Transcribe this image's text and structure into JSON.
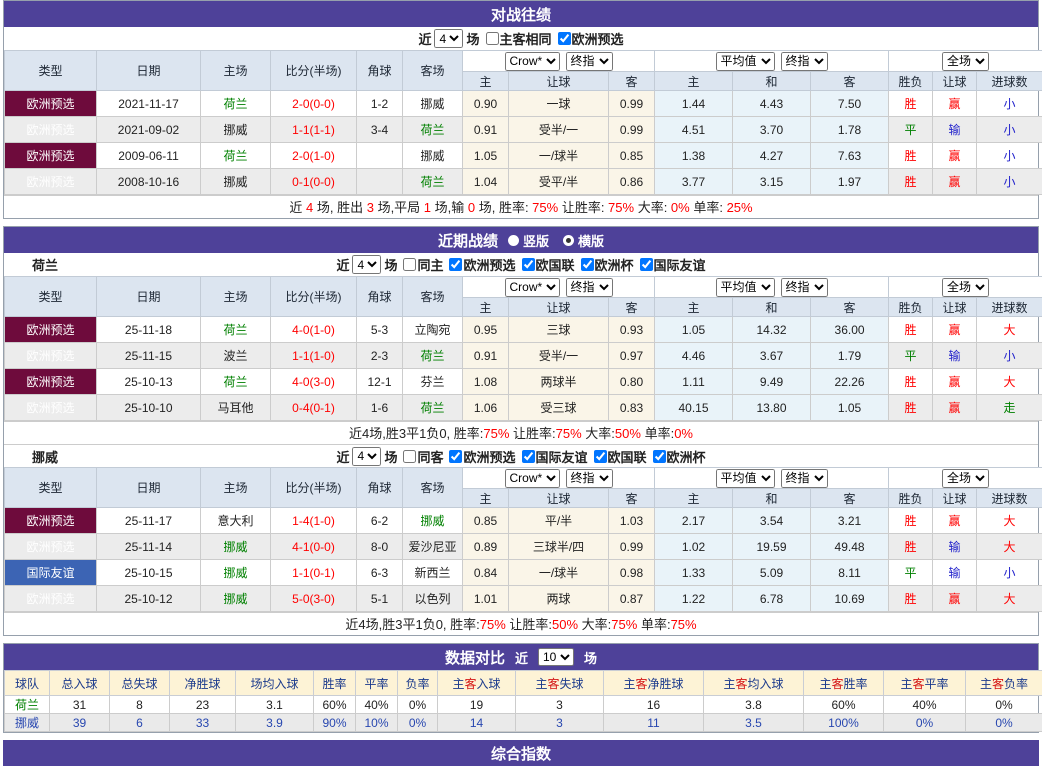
{
  "match_header": {
    "main_cols": [
      "类型",
      "日期",
      "主场",
      "比分(半场)",
      "角球",
      "客场"
    ],
    "dropdowns": [
      "Crow*",
      "终指",
      "平均值",
      "终指",
      "全场"
    ],
    "sub_cols": [
      "主",
      "让球",
      "客",
      "主",
      "和",
      "客",
      "胜负",
      "让球",
      "进球数"
    ]
  },
  "h2h": {
    "title": "对战往绩",
    "controls": {
      "prefix": "近",
      "games": "4",
      "suffix": "场",
      "checks": [
        {
          "label": "主客相同",
          "checked": false
        },
        {
          "label": "欧洲预选",
          "checked": true
        }
      ]
    },
    "rows": [
      [
        [
          "欧洲预选",
          "m"
        ],
        [
          "2021-11-17",
          ""
        ],
        [
          "荷兰",
          "g"
        ],
        [
          "2-0(0-0)",
          "r"
        ],
        [
          "1-2",
          ""
        ],
        [
          "挪威",
          ""
        ],
        [
          "0.90",
          ""
        ],
        [
          "一球",
          ""
        ],
        [
          "0.99",
          ""
        ],
        [
          "1.44",
          ""
        ],
        [
          "4.43",
          ""
        ],
        [
          "7.50",
          ""
        ],
        [
          "胜",
          "r"
        ],
        [
          "赢",
          "r"
        ],
        [
          "小",
          "b"
        ]
      ],
      [
        [
          "欧洲预选",
          "m"
        ],
        [
          "2021-09-02",
          ""
        ],
        [
          "挪威",
          ""
        ],
        [
          "1-1(1-1)",
          "r"
        ],
        [
          "3-4",
          ""
        ],
        [
          "荷兰",
          "g"
        ],
        [
          "0.91",
          ""
        ],
        [
          "受半/一",
          ""
        ],
        [
          "0.99",
          ""
        ],
        [
          "4.51",
          ""
        ],
        [
          "3.70",
          ""
        ],
        [
          "1.78",
          ""
        ],
        [
          "平",
          "g"
        ],
        [
          "输",
          "b"
        ],
        [
          "小",
          "b"
        ]
      ],
      [
        [
          "欧洲预选",
          "m"
        ],
        [
          "2009-06-11",
          ""
        ],
        [
          "荷兰",
          "g"
        ],
        [
          "2-0(1-0)",
          "r"
        ],
        [
          "",
          ""
        ],
        [
          "挪威",
          ""
        ],
        [
          "1.05",
          ""
        ],
        [
          "一/球半",
          ""
        ],
        [
          "0.85",
          ""
        ],
        [
          "1.38",
          ""
        ],
        [
          "4.27",
          ""
        ],
        [
          "7.63",
          ""
        ],
        [
          "胜",
          "r"
        ],
        [
          "赢",
          "r"
        ],
        [
          "小",
          "b"
        ]
      ],
      [
        [
          "欧洲预选",
          "m"
        ],
        [
          "2008-10-16",
          ""
        ],
        [
          "挪威",
          ""
        ],
        [
          "0-1(0-0)",
          "r"
        ],
        [
          "",
          ""
        ],
        [
          "荷兰",
          "g"
        ],
        [
          "1.04",
          ""
        ],
        [
          "受平/半",
          ""
        ],
        [
          "0.86",
          ""
        ],
        [
          "3.77",
          ""
        ],
        [
          "3.15",
          ""
        ],
        [
          "1.97",
          ""
        ],
        [
          "胜",
          "r"
        ],
        [
          "赢",
          "r"
        ],
        [
          "小",
          "b"
        ]
      ]
    ],
    "summary": [
      [
        "近 ",
        ""
      ],
      [
        "4",
        "r"
      ],
      [
        " 场, 胜出 ",
        ""
      ],
      [
        "3",
        "r"
      ],
      [
        " 场,平局 ",
        ""
      ],
      [
        "1",
        "r"
      ],
      [
        " 场,输 ",
        ""
      ],
      [
        "0",
        "r"
      ],
      [
        " 场, 胜率: ",
        ""
      ],
      [
        "75%",
        "r"
      ],
      [
        " 让胜率: ",
        ""
      ],
      [
        "75%",
        "r"
      ],
      [
        " 大率: ",
        ""
      ],
      [
        "0%",
        "r"
      ],
      [
        " 单率: ",
        ""
      ],
      [
        "25%",
        "r"
      ]
    ]
  },
  "recent": {
    "title": "近期战绩",
    "radios": [
      {
        "label": "竖版",
        "selected": false
      },
      {
        "label": "横版",
        "selected": true
      }
    ],
    "teams": [
      {
        "name": "荷兰",
        "controls": {
          "prefix": "近",
          "games": "4",
          "suffix": "场",
          "checks": [
            {
              "label": "同主",
              "checked": false
            },
            {
              "label": "欧洲预选",
              "checked": true
            },
            {
              "label": "欧国联",
              "checked": true
            },
            {
              "label": "欧洲杯",
              "checked": true
            },
            {
              "label": "国际友谊",
              "checked": true
            }
          ]
        },
        "rows": [
          [
            [
              "欧洲预选",
              "m"
            ],
            [
              "25-11-18",
              ""
            ],
            [
              "荷兰",
              "g"
            ],
            [
              "4-0(1-0)",
              "r"
            ],
            [
              "5-3",
              ""
            ],
            [
              "立陶宛",
              ""
            ],
            [
              "0.95",
              ""
            ],
            [
              "三球",
              ""
            ],
            [
              "0.93",
              ""
            ],
            [
              "1.05",
              ""
            ],
            [
              "14.32",
              ""
            ],
            [
              "36.00",
              ""
            ],
            [
              "胜",
              "r"
            ],
            [
              "赢",
              "r"
            ],
            [
              "大",
              "r"
            ]
          ],
          [
            [
              "欧洲预选",
              "m"
            ],
            [
              "25-11-15",
              ""
            ],
            [
              "波兰",
              ""
            ],
            [
              "1-1(1-0)",
              "r"
            ],
            [
              "2-3",
              ""
            ],
            [
              "荷兰",
              "g"
            ],
            [
              "0.91",
              ""
            ],
            [
              "受半/一",
              ""
            ],
            [
              "0.97",
              ""
            ],
            [
              "4.46",
              ""
            ],
            [
              "3.67",
              ""
            ],
            [
              "1.79",
              ""
            ],
            [
              "平",
              "g"
            ],
            [
              "输",
              "b"
            ],
            [
              "小",
              "b"
            ]
          ],
          [
            [
              "欧洲预选",
              "m"
            ],
            [
              "25-10-13",
              ""
            ],
            [
              "荷兰",
              "g"
            ],
            [
              "4-0(3-0)",
              "r"
            ],
            [
              "12-1",
              ""
            ],
            [
              "芬兰",
              ""
            ],
            [
              "1.08",
              ""
            ],
            [
              "两球半",
              ""
            ],
            [
              "0.80",
              ""
            ],
            [
              "1.11",
              ""
            ],
            [
              "9.49",
              ""
            ],
            [
              "22.26",
              ""
            ],
            [
              "胜",
              "r"
            ],
            [
              "赢",
              "r"
            ],
            [
              "大",
              "r"
            ]
          ],
          [
            [
              "欧洲预选",
              "m"
            ],
            [
              "25-10-10",
              ""
            ],
            [
              "马耳他",
              ""
            ],
            [
              "0-4(0-1)",
              "r"
            ],
            [
              "1-6",
              ""
            ],
            [
              "荷兰",
              "g"
            ],
            [
              "1.06",
              ""
            ],
            [
              "受三球",
              ""
            ],
            [
              "0.83",
              ""
            ],
            [
              "40.15",
              ""
            ],
            [
              "13.80",
              ""
            ],
            [
              "1.05",
              ""
            ],
            [
              "胜",
              "r"
            ],
            [
              "赢",
              "r"
            ],
            [
              "走",
              "g"
            ]
          ]
        ],
        "summary": [
          [
            "近4场,胜3平1负0, 胜率:",
            ""
          ],
          [
            "75%",
            "r"
          ],
          [
            " 让胜率:",
            ""
          ],
          [
            "75%",
            "r"
          ],
          [
            " 大率:",
            ""
          ],
          [
            "50%",
            "r"
          ],
          [
            " 单率:",
            ""
          ],
          [
            "0%",
            "r"
          ]
        ]
      },
      {
        "name": "挪威",
        "controls": {
          "prefix": "近",
          "games": "4",
          "suffix": "场",
          "checks": [
            {
              "label": "同客",
              "checked": false
            },
            {
              "label": "欧洲预选",
              "checked": true
            },
            {
              "label": "国际友谊",
              "checked": true
            },
            {
              "label": "欧国联",
              "checked": true
            },
            {
              "label": "欧洲杯",
              "checked": true
            }
          ]
        },
        "rows": [
          [
            [
              "欧洲预选",
              "m"
            ],
            [
              "25-11-17",
              ""
            ],
            [
              "意大利",
              ""
            ],
            [
              "1-4(1-0)",
              "r"
            ],
            [
              "6-2",
              ""
            ],
            [
              "挪威",
              "g"
            ],
            [
              "0.85",
              ""
            ],
            [
              "平/半",
              ""
            ],
            [
              "1.03",
              ""
            ],
            [
              "2.17",
              ""
            ],
            [
              "3.54",
              ""
            ],
            [
              "3.21",
              ""
            ],
            [
              "胜",
              "r"
            ],
            [
              "赢",
              "r"
            ],
            [
              "大",
              "r"
            ]
          ],
          [
            [
              "欧洲预选",
              "m"
            ],
            [
              "25-11-14",
              ""
            ],
            [
              "挪威",
              "g"
            ],
            [
              "4-1(0-0)",
              "r"
            ],
            [
              "8-0",
              ""
            ],
            [
              "爱沙尼亚",
              ""
            ],
            [
              "0.89",
              ""
            ],
            [
              "三球半/四",
              ""
            ],
            [
              "0.99",
              ""
            ],
            [
              "1.02",
              ""
            ],
            [
              "19.59",
              ""
            ],
            [
              "49.48",
              ""
            ],
            [
              "胜",
              "r"
            ],
            [
              "输",
              "b"
            ],
            [
              "大",
              "r"
            ]
          ],
          [
            [
              "国际友谊",
              "f"
            ],
            [
              "25-10-15",
              ""
            ],
            [
              "挪威",
              "g"
            ],
            [
              "1-1(0-1)",
              "r"
            ],
            [
              "6-3",
              ""
            ],
            [
              "新西兰",
              ""
            ],
            [
              "0.84",
              ""
            ],
            [
              "一/球半",
              ""
            ],
            [
              "0.98",
              ""
            ],
            [
              "1.33",
              ""
            ],
            [
              "5.09",
              ""
            ],
            [
              "8.11",
              ""
            ],
            [
              "平",
              "g"
            ],
            [
              "输",
              "b"
            ],
            [
              "小",
              "b"
            ]
          ],
          [
            [
              "欧洲预选",
              "m"
            ],
            [
              "25-10-12",
              ""
            ],
            [
              "挪威",
              "g"
            ],
            [
              "5-0(3-0)",
              "r"
            ],
            [
              "5-1",
              ""
            ],
            [
              "以色列",
              ""
            ],
            [
              "1.01",
              ""
            ],
            [
              "两球",
              ""
            ],
            [
              "0.87",
              ""
            ],
            [
              "1.22",
              ""
            ],
            [
              "6.78",
              ""
            ],
            [
              "10.69",
              ""
            ],
            [
              "胜",
              "r"
            ],
            [
              "赢",
              "r"
            ],
            [
              "大",
              "r"
            ]
          ]
        ],
        "summary": [
          [
            "近4场,胜3平1负0, 胜率:",
            ""
          ],
          [
            "75%",
            "r"
          ],
          [
            " 让胜率:",
            ""
          ],
          [
            "50%",
            "r"
          ],
          [
            " 大率:",
            ""
          ],
          [
            "75%",
            "r"
          ],
          [
            " 单率:",
            ""
          ],
          [
            "75%",
            "r"
          ]
        ]
      }
    ]
  },
  "compare": {
    "title": "数据对比",
    "prefix": "近",
    "games": "10",
    "suffix": "场",
    "headers": [
      [
        [
          "球队",
          ""
        ]
      ],
      [
        [
          "总入球",
          ""
        ]
      ],
      [
        [
          "总失球",
          ""
        ]
      ],
      [
        [
          "净胜球",
          ""
        ]
      ],
      [
        [
          "场均入球",
          ""
        ]
      ],
      [
        [
          "胜率",
          ""
        ]
      ],
      [
        [
          "平率",
          ""
        ]
      ],
      [
        [
          "负率",
          ""
        ]
      ],
      [
        [
          "主",
          ""
        ],
        [
          "客",
          "hr"
        ],
        [
          "入球",
          ""
        ]
      ],
      [
        [
          "主",
          ""
        ],
        [
          "客",
          "hr"
        ],
        [
          "失球",
          ""
        ]
      ],
      [
        [
          "主",
          ""
        ],
        [
          "客",
          "hr"
        ],
        [
          "净胜球",
          ""
        ]
      ],
      [
        [
          "主",
          ""
        ],
        [
          "客",
          "hr"
        ],
        [
          "均入球",
          ""
        ]
      ],
      [
        [
          "主",
          ""
        ],
        [
          "客",
          "hr"
        ],
        [
          "胜率",
          ""
        ]
      ],
      [
        [
          "主",
          ""
        ],
        [
          "客",
          "hr"
        ],
        [
          "平率",
          ""
        ]
      ],
      [
        [
          "主",
          ""
        ],
        [
          "客",
          "hr"
        ],
        [
          "负率",
          ""
        ]
      ]
    ],
    "rows": [
      {
        "team_color": "g",
        "alt": false,
        "cells": [
          "荷兰",
          "31",
          "8",
          "23",
          "3.1",
          "60%",
          "40%",
          "0%",
          "19",
          "3",
          "16",
          "3.8",
          "60%",
          "40%",
          "0%"
        ]
      },
      {
        "team_color": "b",
        "alt": true,
        "cells": [
          "挪威",
          "39",
          "6",
          "33",
          "3.9",
          "90%",
          "10%",
          "0%",
          "14",
          "3",
          "11",
          "3.5",
          "100%",
          "0%",
          "0%"
        ]
      }
    ]
  },
  "footer": {
    "title": "综合指数"
  }
}
